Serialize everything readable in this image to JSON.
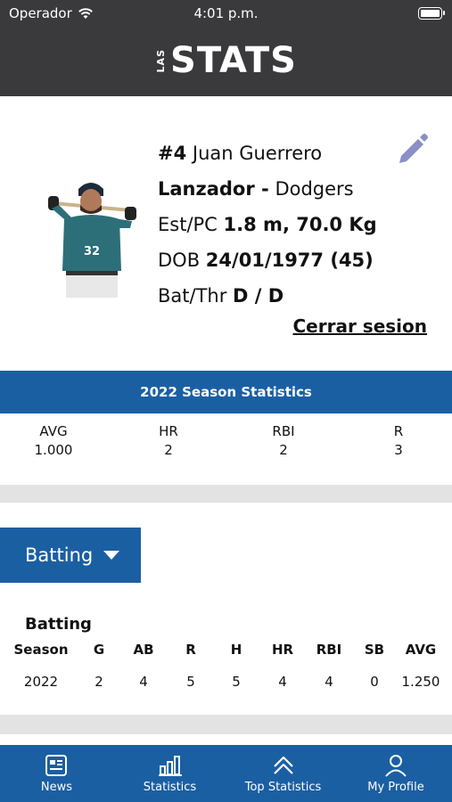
{
  "status_bar": {
    "carrier": "Operador",
    "time": "4:01 p.m."
  },
  "app": {
    "logo_small": "LAS",
    "logo_main": "STATS"
  },
  "player": {
    "number": "#4",
    "name": "Juan Guerrero",
    "position": "Lanzador -",
    "team": "Dodgers",
    "height_weight_label": "Est/PC",
    "height_weight": "1.8 m, 70.0 Kg",
    "dob_label": "DOB",
    "dob": "24/01/1977 (45)",
    "bat_thr_label": "Bat/Thr",
    "bat_thr": "D / D",
    "jersey": "32"
  },
  "logout_label": "Cerrar sesion",
  "season": {
    "title": "2022  Season Statistics",
    "stats": [
      {
        "label": "AVG",
        "value": "1.000"
      },
      {
        "label": "HR",
        "value": "2"
      },
      {
        "label": "RBI",
        "value": "2"
      },
      {
        "label": "R",
        "value": "3"
      }
    ]
  },
  "dropdown": {
    "selected": "Batting"
  },
  "batting": {
    "title": "Batting",
    "headers": [
      "Season",
      "G",
      "AB",
      "R",
      "H",
      "HR",
      "RBI",
      "SB",
      "AVG"
    ],
    "rows": [
      [
        "2022",
        "2",
        "4",
        "5",
        "5",
        "4",
        "4",
        "0",
        "1.250"
      ]
    ]
  },
  "tabs": [
    {
      "label": "News",
      "icon": "news-icon"
    },
    {
      "label": "Statistics",
      "icon": "statistics-icon"
    },
    {
      "label": "Top Statistics",
      "icon": "top-statistics-icon"
    },
    {
      "label": "My Profile",
      "icon": "profile-icon"
    }
  ],
  "colors": {
    "header": "#3a3a3d",
    "accent": "#1b5fa3",
    "band": "#e3e3e3",
    "edit_icon": "#8a8fc7"
  }
}
